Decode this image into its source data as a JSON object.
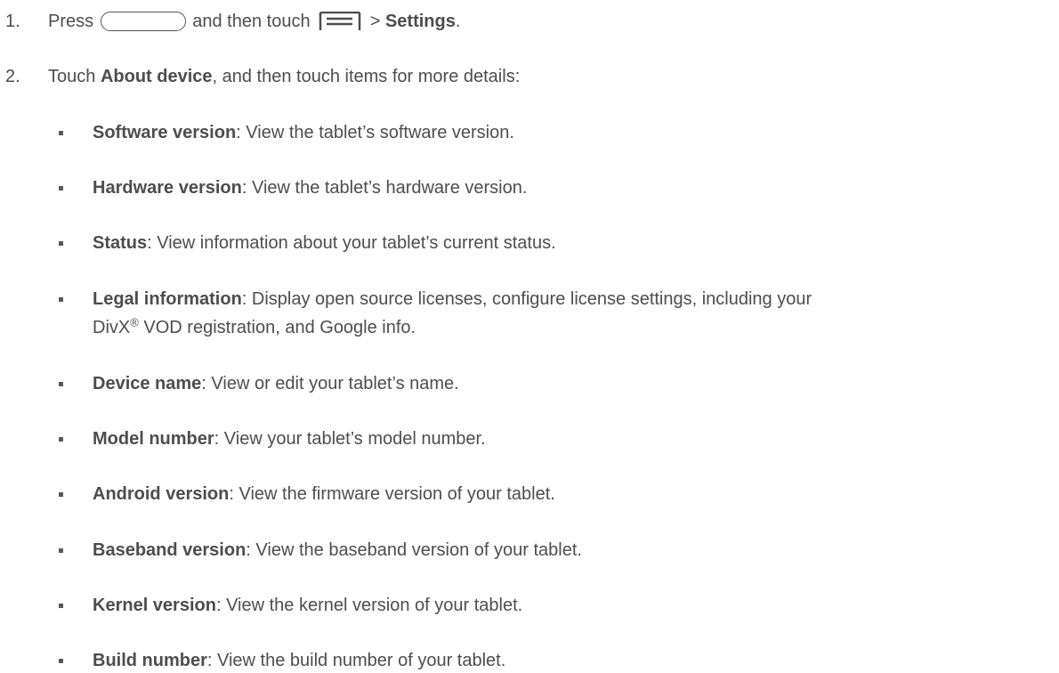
{
  "steps": [
    {
      "num": "1.",
      "t1": "Press",
      "t2": "and then touch",
      "t3": ">",
      "b1": "Settings",
      "t4": ".",
      "icons": [
        "home-key-icon",
        "menu-key-icon"
      ]
    },
    {
      "num": "2.",
      "t1": "Touch",
      "b1": "About device",
      "t2": ", and then touch items for more details:"
    }
  ],
  "items": [
    {
      "term": "Software version",
      "desc": ": View the tablet’s software version."
    },
    {
      "term": "Hardware version",
      "desc": ": View the tablet’s hardware version."
    },
    {
      "term": "Status",
      "desc": ": View information about your tablet’s current status."
    },
    {
      "term": "Legal information",
      "desc": ": Display open source licenses, configure license settings, including your",
      "line2_a": "DivX",
      "line2_sup": "®",
      "line2_b": " VOD registration, and Google info."
    },
    {
      "term": "Device name",
      "desc": ": View or edit your tablet’s name."
    },
    {
      "term": "Model number",
      "desc": ": View your tablet’s model number."
    },
    {
      "term": "Android version",
      "desc": ": View the firmware version of your tablet."
    },
    {
      "term": "Baseband version",
      "desc": ": View the baseband version of your tablet."
    },
    {
      "term": "Kernel version",
      "desc": ": View the kernel version of your tablet."
    },
    {
      "term": "Build number",
      "desc": ": View the build number of your tablet."
    }
  ]
}
